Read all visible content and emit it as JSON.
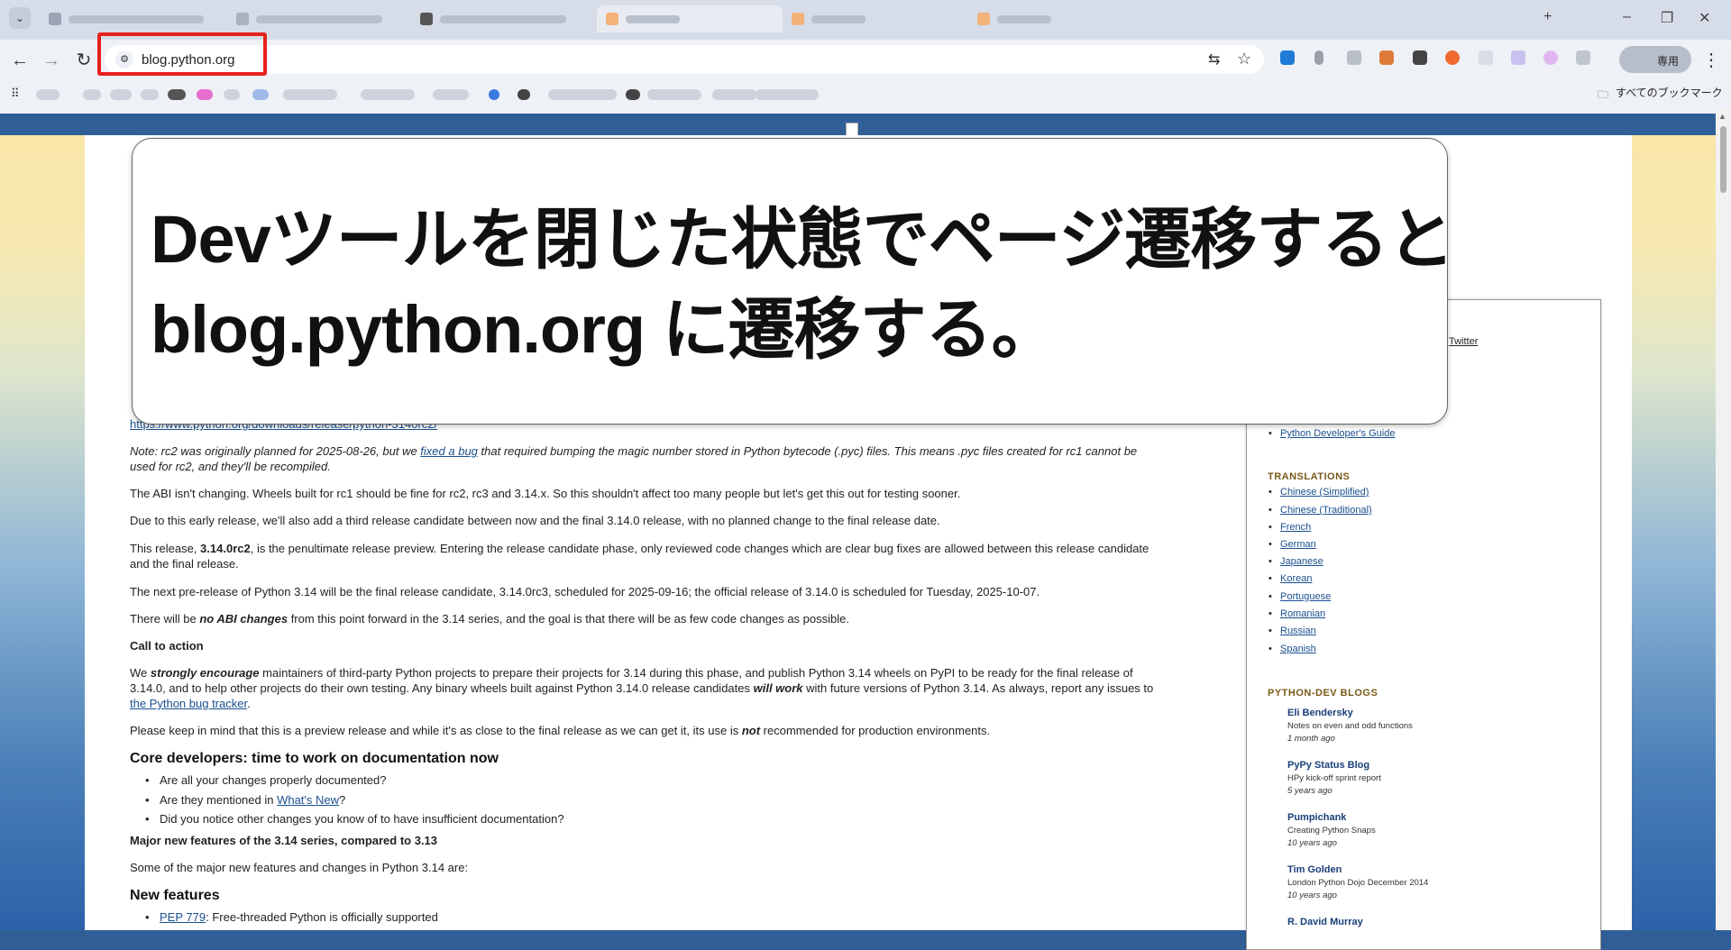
{
  "browser": {
    "url": "blog.python.org",
    "profile_label": "専用",
    "all_bookmarks_label": "すべてのブックマーク"
  },
  "annotation": {
    "line1": "Devツールを閉じた状態でページ遷移すると",
    "line2": "blog.python.org に遷移する。"
  },
  "article": {
    "link_partial": "https://www.python.org/downloads/release/python-3140rc2/",
    "note": {
      "pre": "Note: rc2 was originally planned for 2025-08-26, but we ",
      "link": "fixed a bug",
      "post": " that required bumping the magic number stored in Python bytecode (.pyc) files. This means .pyc files created for rc1 cannot be used for rc2, and they'll be recompiled."
    },
    "p_abi": "The ABI isn't changing. Wheels built for rc1 should be fine for rc2, rc3 and 3.14.x. So this shouldn't affect too many people but let's get this out for testing sooner.",
    "p_due": "Due to this early release, we'll also add a third release candidate between now and the final 3.14.0 release, with no planned change to the final release date.",
    "p_release": {
      "pre": "This release, ",
      "bold": "3.14.0rc2",
      "post": ", is the penultimate release preview. Entering the release candidate phase, only reviewed code changes which are clear bug fixes are allowed between this release candidate and the final release."
    },
    "p_next": "The next pre-release of Python 3.14 will be the final release candidate, 3.14.0rc3, scheduled for 2025-09-16; the official release of 3.14.0 is scheduled for Tuesday, 2025-10-07.",
    "p_noabi": {
      "pre": "There will be ",
      "bold": "no ABI changes",
      "post": " from this point forward in the 3.14 series, and the goal is that there will be as few code changes as possible."
    },
    "call_to_action": "Call to action",
    "p_encourage": {
      "pre": "We ",
      "bold": "strongly encourage",
      "mid": " maintainers of third-party Python projects to prepare their projects for 3.14 during this phase, and publish Python 3.14 wheels on PyPI to be ready for the final release of 3.14.0, and to help other projects do their own testing. Any binary wheels built against Python 3.14.0 release candidates ",
      "bold2": "will work",
      "post": " with future versions of Python 3.14. As always, report any issues to ",
      "link": "the Python bug tracker",
      "end": "."
    },
    "p_preview": {
      "pre": "Please keep in mind that this is a preview release and while it's as close to the final release as we can get it, its use is ",
      "bold": "not",
      "post": " recommended for production environments."
    },
    "h_core": "Core developers: time to work on documentation now",
    "core_items": [
      "Are all your changes properly documented?",
      "Are they mentioned in ",
      "Did you notice other changes you know of to have insufficient documentation?"
    ],
    "whats_new_link": "What's New",
    "q_mark": "?",
    "major_features": "Major new features of the 3.14 series, compared to 3.13",
    "p_some": "Some of the major new features and changes in Python 3.14 are:",
    "h_new": "New features",
    "pep_link": "PEP 779",
    "pep_text": ": Free-threaded Python is officially supported"
  },
  "sidebar": {
    "twitter": "Twitter",
    "dev_guide": "Python Developer's Guide",
    "translations_heading": "TRANSLATIONS",
    "translations": [
      "Chinese (Simplified)",
      "Chinese (Traditional)",
      "French",
      "German",
      "Japanese",
      "Korean",
      "Portuguese",
      "Romanian",
      "Russian",
      "Spanish"
    ],
    "blogs_heading": "PYTHON-DEV BLOGS",
    "blogs": [
      {
        "name": "Eli Bendersky",
        "desc": "Notes on even and odd functions",
        "time": "1 month ago"
      },
      {
        "name": "PyPy Status Blog",
        "desc": "HPy kick-off sprint report",
        "time": "5 years ago"
      },
      {
        "name": "Pumpichank",
        "desc": "Creating Python Snaps",
        "time": "10 years ago"
      },
      {
        "name": "Tim Golden",
        "desc": "London Python Dojo December 2014",
        "time": "10 years ago"
      },
      {
        "name": "R. David Murray",
        "desc": "",
        "time": ""
      }
    ]
  },
  "colors": {
    "highlight": "#e8211d",
    "link": "#1a4f8f",
    "sidebar_heading": "#7a5a1a"
  }
}
